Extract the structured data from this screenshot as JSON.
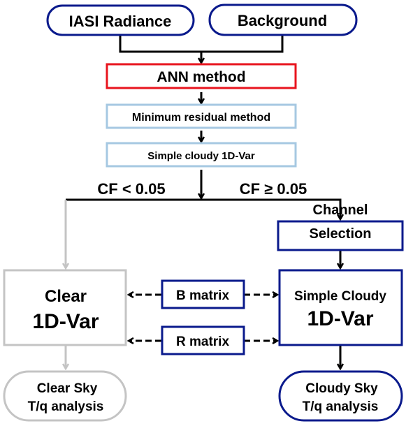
{
  "colors": {
    "navy": "#0a1a8c",
    "red": "#e8141e",
    "light_blue": "#a6c8e2",
    "gray": "#c4c4c4",
    "black": "#000000"
  },
  "nodes": {
    "iasi": "IASI Radiance",
    "background": "Background",
    "ann": "ANN method",
    "min_residual": "Minimum residual method",
    "simple_cloudy_top": "Simple cloudy 1D-Var",
    "channel_line1": "Channel",
    "channel_line2": "Selection",
    "clear_line1": "Clear",
    "clear_line2": "1D-Var",
    "b_matrix": "B matrix",
    "r_matrix": "R matrix",
    "cloudy_line1": "Simple Cloudy",
    "cloudy_line2": "1D-Var",
    "clear_sky_line1": "Clear Sky",
    "clear_sky_line2": "T/q analysis",
    "cloudy_sky_line1": "Cloudy Sky",
    "cloudy_sky_line2": "T/q analysis"
  },
  "conditions": {
    "clear": "CF < 0.05",
    "cloudy": "CF ≥ 0.05"
  }
}
